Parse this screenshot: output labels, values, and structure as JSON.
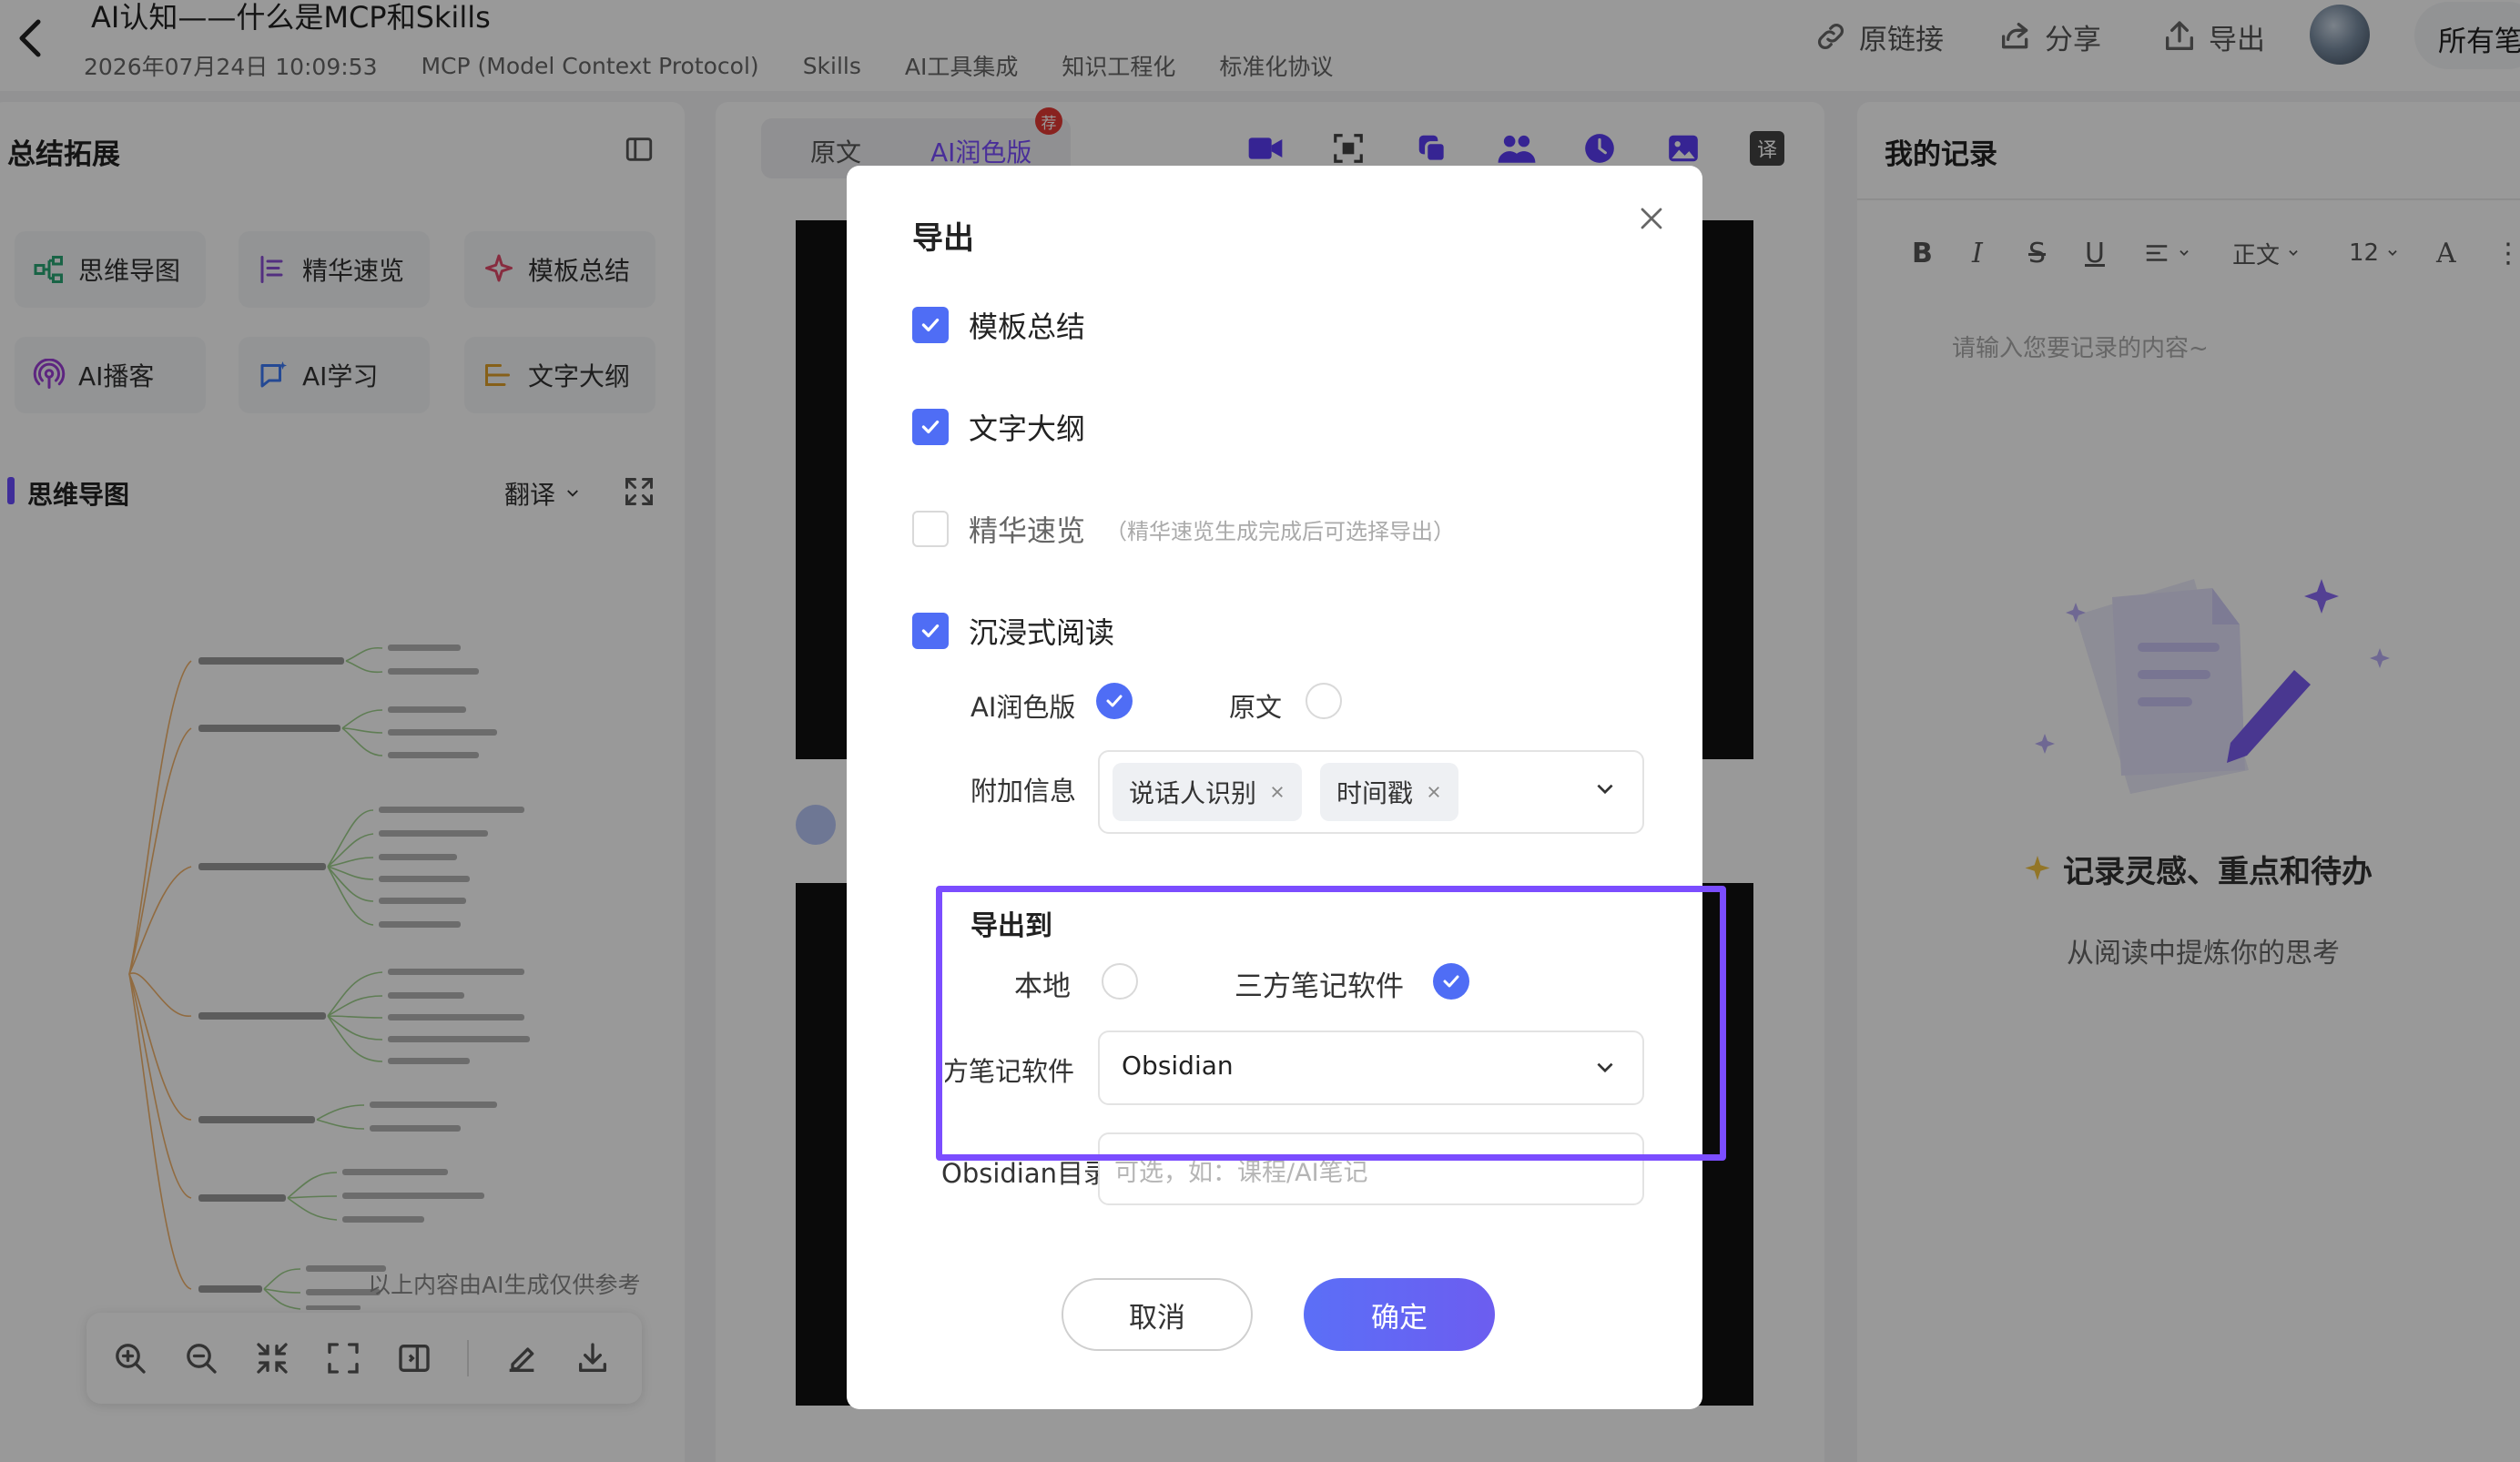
{
  "header": {
    "title": "AI认知——什么是MCP和Skills",
    "datetime": "2026年07月24日 10:09:53",
    "tags": [
      "MCP (Model Context Protocol)",
      "Skills",
      "AI工具集成",
      "知识工程化",
      "标准化协议"
    ],
    "actions": {
      "source_link": "原链接",
      "share": "分享",
      "export": "导出"
    },
    "all_notes": "所有笔"
  },
  "left": {
    "title": "总结拓展",
    "features": [
      "思维导图",
      "精华速览",
      "模板总结",
      "AI播客",
      "AI学习",
      "文字大纲"
    ],
    "mindmap_title": "思维导图",
    "translate": "翻译",
    "ai_note": "以上内容由AI生成仅供参考"
  },
  "mid": {
    "tab_original": "原文",
    "tab_ai": "AI润色版",
    "recommend_badge": "荐",
    "translate_icon": "译"
  },
  "right": {
    "title": "我的记录",
    "style_select": "正文",
    "size_select": "12",
    "placeholder": "请输入您要记录的内容~",
    "empty_title": "记录灵感、重点和待办",
    "empty_sub": "从阅读中提炼你的思考"
  },
  "modal": {
    "title": "导出",
    "options": {
      "template_summary": {
        "label": "模板总结",
        "checked": true
      },
      "text_outline": {
        "label": "文字大纲",
        "checked": true
      },
      "highlights": {
        "label": "精华速览",
        "checked": false,
        "hint": "（精华速览生成完成后可选择导出）"
      },
      "immersive": {
        "label": "沉浸式阅读",
        "checked": true
      }
    },
    "version": {
      "ai": "AI润色版",
      "original": "原文",
      "selected": "AI润色版"
    },
    "extra_label": "附加信息",
    "extra_tags": [
      "说话人识别",
      "时间戳"
    ],
    "export_to_label": "导出到",
    "local": "本地",
    "third_party": "三方笔记软件",
    "destination_selected": "三方笔记软件",
    "third_party_field_label": "三方笔记软件",
    "third_party_value": "Obsidian",
    "dir_label": "Obsidian目录",
    "dir_placeholder": "可选，如：课程/AI笔记",
    "cancel": "取消",
    "confirm": "确定"
  },
  "colors": {
    "accent": "#4f6df5",
    "highlight_border": "#7b4dff",
    "ai_tab": "#7b4dff",
    "recommend": "#e53935"
  }
}
